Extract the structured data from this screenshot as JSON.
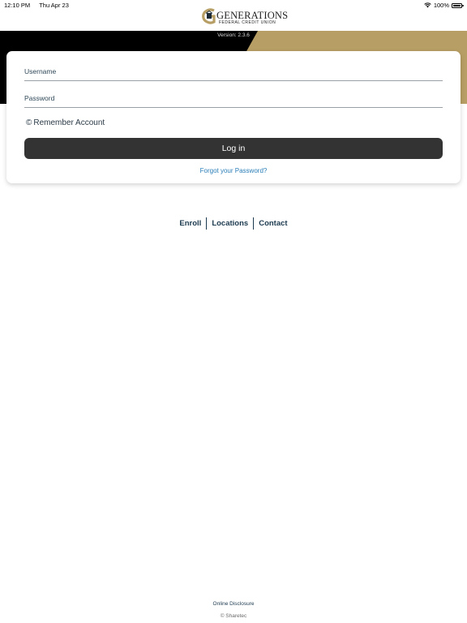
{
  "status_bar": {
    "time": "12:10 PM",
    "date": "Thu Apr 23",
    "battery": "100%",
    "battery_level": 1.0
  },
  "logo": {
    "title": "GENERATIONS",
    "subtitle": "FEDERAL CREDIT UNION"
  },
  "banner": {
    "version": "Version: 2.3.6"
  },
  "colors": {
    "banner_black": "#000000",
    "banner_gold": "#b79e64",
    "button_bg": "#333333",
    "link_blue": "#2a7eb8"
  },
  "login": {
    "username_label": "Username",
    "username_value": "",
    "password_label": "Password",
    "password_value": "",
    "remember_label": "Remember Account",
    "remember_icon": "copyright-circle-icon",
    "login_button": "Log in",
    "forgot_link": "Forgot your Password?"
  },
  "links": {
    "enroll": "Enroll",
    "locations": "Locations",
    "contact": "Contact"
  },
  "footer": {
    "disclosure": "Online Disclosure",
    "copyright": "© Sharetec"
  }
}
